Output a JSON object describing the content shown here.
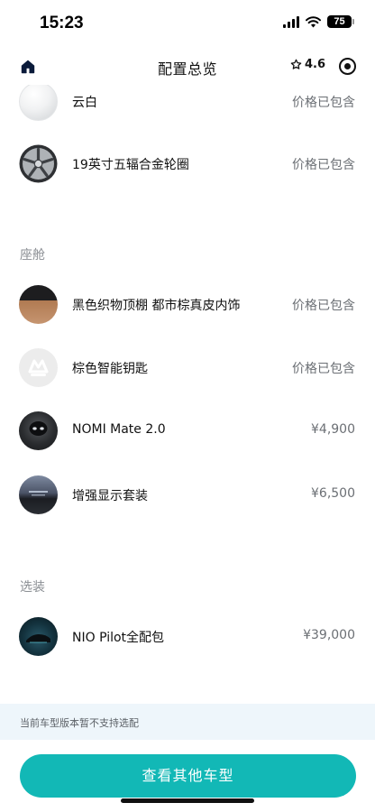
{
  "status_bar": {
    "time": "15:23",
    "battery": "75"
  },
  "nav": {
    "title": "配置总览",
    "rating": "4.6"
  },
  "exterior_items": [
    {
      "name": "云白",
      "price": "价格已包含"
    },
    {
      "name": "19英寸五辐合金轮圈",
      "price": "价格已包含"
    }
  ],
  "cabin": {
    "title": "座舱",
    "items": [
      {
        "name": "黑色织物顶棚 都市棕真皮内饰",
        "price": "价格已包含"
      },
      {
        "name": "棕色智能钥匙",
        "price": "价格已包含"
      },
      {
        "name": "NOMI Mate 2.0",
        "price": "¥4,900"
      },
      {
        "name": "增强显示套装",
        "price": "¥6,500"
      }
    ]
  },
  "options": {
    "title": "选装",
    "items": [
      {
        "name": "NIO Pilot全配包",
        "price": "¥39,000"
      }
    ]
  },
  "notice": "当前车型版本暂不支持选配",
  "cta_label": "查看其他车型",
  "colors": {
    "accent": "#12b8b6",
    "notice_bg": "#eef6fb",
    "muted_text": "#8a8e93"
  }
}
